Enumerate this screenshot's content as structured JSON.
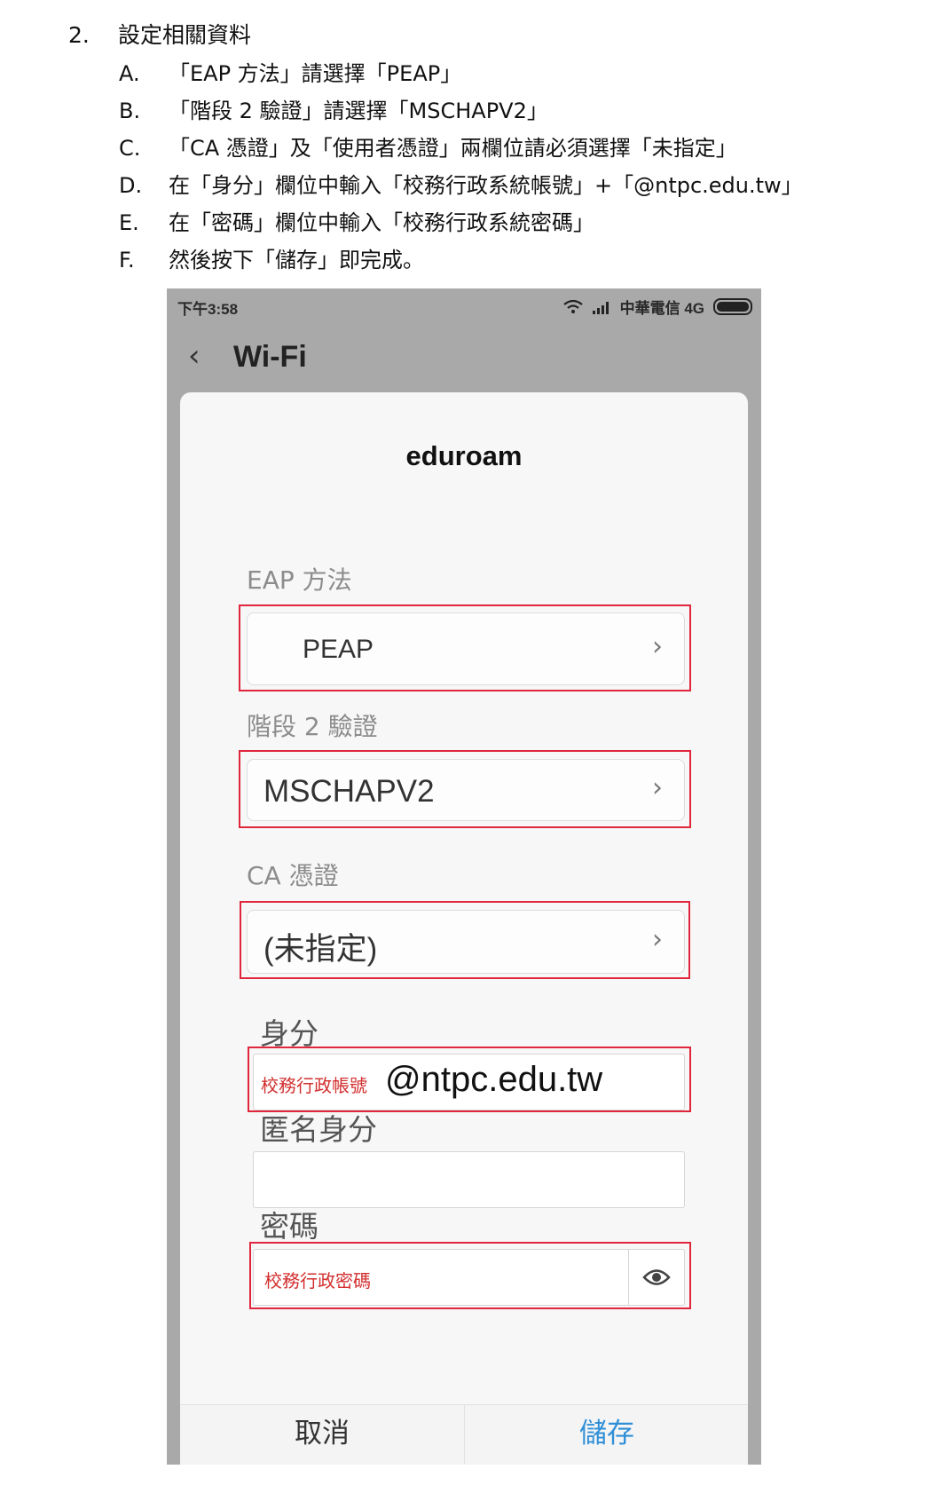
{
  "instructions": {
    "step_number": "2.",
    "heading": "設定相關資料",
    "items": [
      {
        "letter": "A.",
        "text": "「EAP 方法」請選擇「PEAP」"
      },
      {
        "letter": "B.",
        "text": "「階段 2 驗證」請選擇「MSCHAPV2」"
      },
      {
        "letter": "C.",
        "text": "「CA 憑證」及「使用者憑證」兩欄位請必須選擇「未指定」"
      },
      {
        "letter": "D.",
        "text": "在「身分」欄位中輸入「校務行政系統帳號」+「@ntpc.edu.tw」"
      },
      {
        "letter": "E.",
        "text": "在「密碼」欄位中輸入「校務行政系統密碼」"
      },
      {
        "letter": "F.",
        "text": "然後按下「儲存」即完成。"
      }
    ]
  },
  "phone": {
    "status": {
      "time": "下午3:58",
      "carrier": "中華電信 4G"
    },
    "nav": {
      "back_glyph": "‹",
      "title": "Wi-Fi"
    },
    "dialog": {
      "title": "eduroam",
      "eap": {
        "label": "EAP 方法",
        "value": "PEAP"
      },
      "phase2": {
        "label": "階段 2 驗證",
        "value": "MSCHAPV2"
      },
      "ca": {
        "label": "CA 憑證",
        "value": "(未指定)"
      },
      "identity": {
        "label": "身分",
        "note": "校務行政帳號",
        "value": "@ntpc.edu.tw"
      },
      "anon": {
        "label": "匿名身分",
        "value": ""
      },
      "password": {
        "label": "密碼",
        "note": "校務行政密碼"
      },
      "buttons": {
        "cancel": "取消",
        "save": "儲存"
      }
    }
  },
  "colors": {
    "highlight": "#e0263c",
    "save": "#2f8fd8",
    "note": "#d32f2f"
  },
  "icons": {
    "chevron": "chevron-right-icon",
    "eye": "eye-icon",
    "wifi": "wifi-icon",
    "signal": "signal-icon",
    "battery": "battery-icon",
    "back": "back-arrow-icon"
  }
}
